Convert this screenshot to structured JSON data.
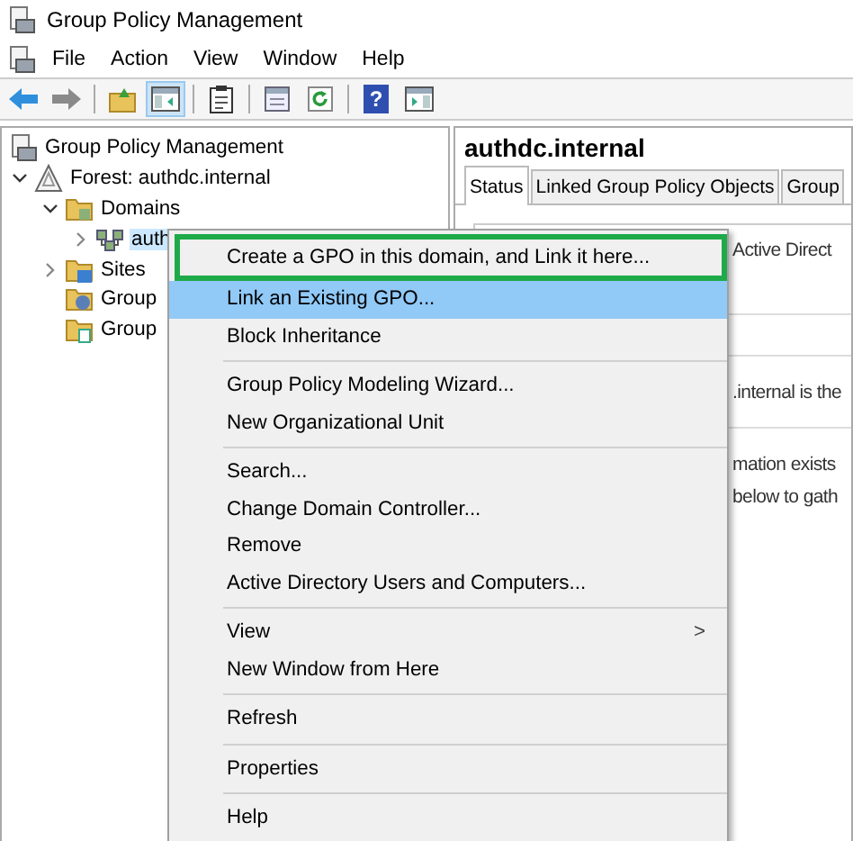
{
  "window": {
    "title": "Group Policy Management"
  },
  "menu_bar": [
    "File",
    "Action",
    "View",
    "Window",
    "Help"
  ],
  "toolbar": [
    {
      "kind": "back",
      "pressed": false
    },
    {
      "kind": "forward",
      "pressed": false
    },
    {
      "kind": "sep"
    },
    {
      "kind": "up",
      "pressed": false
    },
    {
      "kind": "tree",
      "pressed": true
    },
    {
      "kind": "sep"
    },
    {
      "kind": "clipboard",
      "pressed": false
    },
    {
      "kind": "sep"
    },
    {
      "kind": "properties",
      "pressed": false
    },
    {
      "kind": "refresh",
      "pressed": false
    },
    {
      "kind": "sep"
    },
    {
      "kind": "help",
      "glyph": "?",
      "pressed": false
    },
    {
      "kind": "panel",
      "pressed": false
    }
  ],
  "tree": [
    {
      "label": "Group Policy Management",
      "selected": false,
      "children": [
        {
          "label": "Forest: authdc.internal",
          "expanded": true,
          "selected": false,
          "children": [
            {
              "label": "Domains",
              "expanded": true,
              "selected": false,
              "children": [
                {
                  "label": "auth",
                  "expanded": false,
                  "selected": true
                }
              ]
            },
            {
              "label": "Sites",
              "expanded": false,
              "selected": false
            },
            {
              "label": "Group",
              "selected": false
            },
            {
              "label": "Group",
              "selected": false
            }
          ]
        }
      ]
    }
  ],
  "details": {
    "heading": "authdc.internal",
    "tabs": [
      {
        "label": "Status",
        "selected": true
      },
      {
        "label": "Linked Group Policy Objects",
        "selected": false
      },
      {
        "label": "Group",
        "selected": false
      }
    ],
    "fragments": [
      "Active Direct",
      ".internal is the",
      "mation exists",
      "below to gath"
    ]
  },
  "context_menu": [
    {
      "kind": "item",
      "label": "Create a GPO in this domain, and Link it here...",
      "selected": false,
      "outlined": true
    },
    {
      "kind": "item",
      "label": "Link an Existing GPO...",
      "selected": true,
      "outlined": false
    },
    {
      "kind": "item",
      "label": "Block Inheritance",
      "selected": false,
      "outlined": false
    },
    {
      "kind": "separator"
    },
    {
      "kind": "item",
      "label": "Group Policy Modeling Wizard...",
      "selected": false,
      "outlined": false
    },
    {
      "kind": "item",
      "label": "New Organizational Unit",
      "selected": false,
      "outlined": false
    },
    {
      "kind": "separator"
    },
    {
      "kind": "item",
      "label": "Search...",
      "selected": false,
      "outlined": false
    },
    {
      "kind": "item",
      "label": "Change Domain Controller...",
      "selected": false,
      "outlined": false
    },
    {
      "kind": "item",
      "label": "Remove",
      "selected": false,
      "outlined": false
    },
    {
      "kind": "item",
      "label": "Active Directory Users and Computers...",
      "selected": false,
      "outlined": false
    },
    {
      "kind": "separator"
    },
    {
      "kind": "item",
      "label": "View",
      "submenu": ">",
      "selected": false,
      "outlined": false
    },
    {
      "kind": "item",
      "label": "New Window from Here",
      "selected": false,
      "outlined": false
    },
    {
      "kind": "separator"
    },
    {
      "kind": "item",
      "label": "Refresh",
      "selected": false,
      "outlined": false
    },
    {
      "kind": "separator"
    },
    {
      "kind": "item",
      "label": "Properties",
      "selected": false,
      "outlined": false
    },
    {
      "kind": "separator"
    },
    {
      "kind": "item",
      "label": "Help",
      "selected": false,
      "outlined": false
    }
  ]
}
